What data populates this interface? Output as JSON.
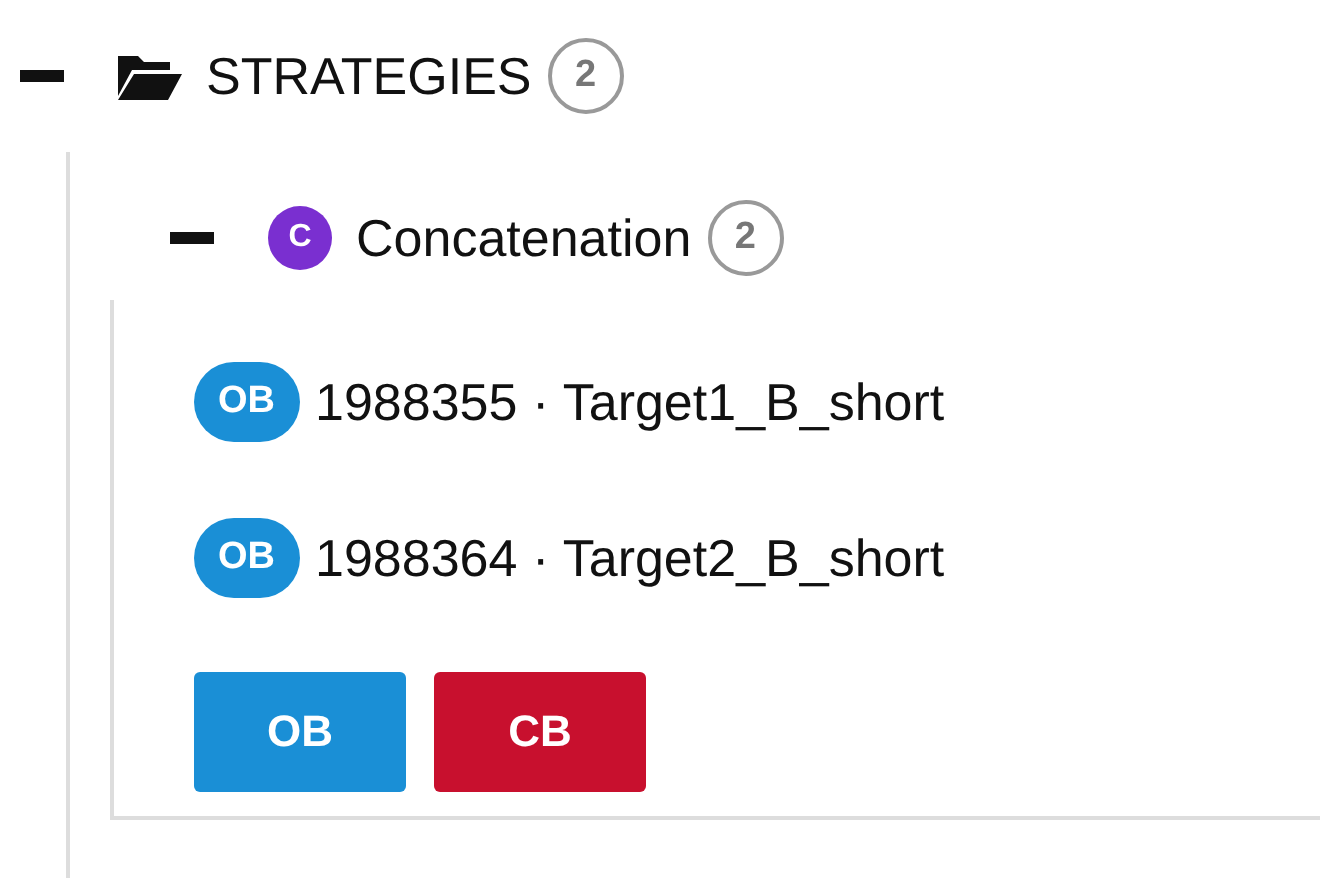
{
  "tree": {
    "label": "STRATEGIES",
    "count": "2",
    "expanded": true,
    "children": [
      {
        "label": "Concatenation",
        "badge": "C",
        "count": "2",
        "expanded": true,
        "children": [
          {
            "badge": "OB",
            "label": "1988355 · Target1_B_short"
          },
          {
            "badge": "OB",
            "label": "1988364 · Target2_B_short"
          }
        ],
        "buttons": [
          {
            "label": "OB",
            "kind": "ob"
          },
          {
            "label": "CB",
            "kind": "cb"
          }
        ]
      }
    ]
  }
}
